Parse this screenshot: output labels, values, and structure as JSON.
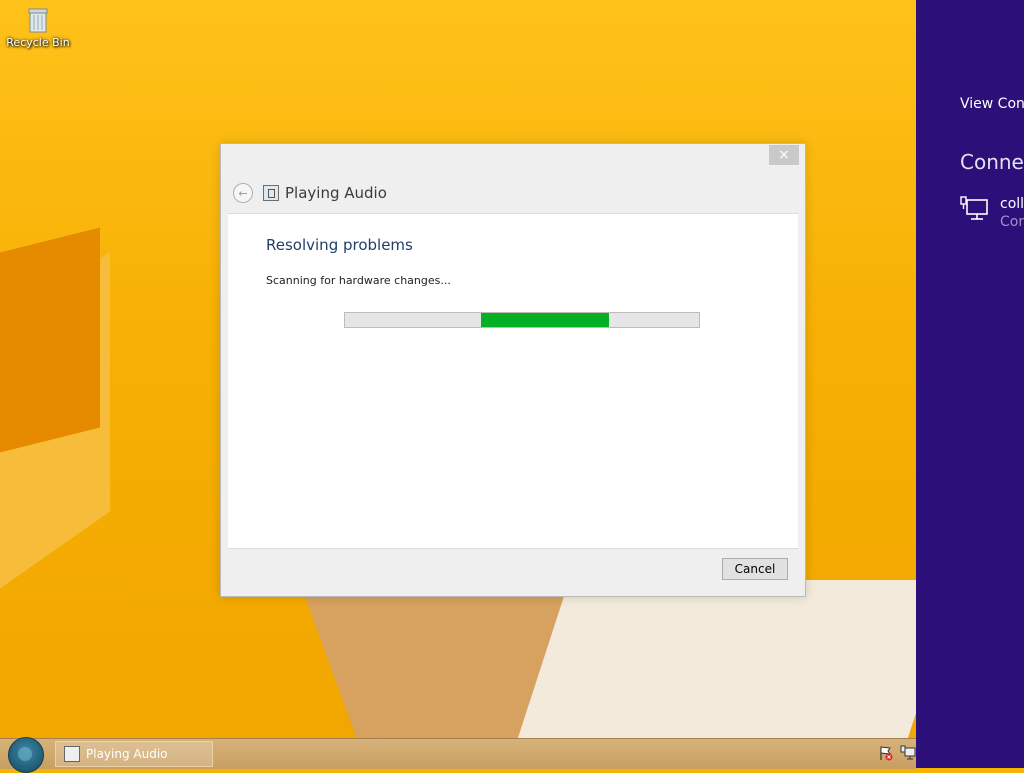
{
  "desktop": {
    "recycle_bin_label": "Recycle Bin"
  },
  "dialog": {
    "title": "Playing Audio",
    "heading": "Resolving problems",
    "status": "Scanning for hardware changes...",
    "progress_fraction": 0.36,
    "cancel_label": "Cancel",
    "close_symbol": "×"
  },
  "charm": {
    "view_link": "View Conn",
    "heading": "Connec",
    "connection_name": "coll",
    "connection_status": "Con"
  },
  "taskbar": {
    "app_label": "Playing Audio"
  },
  "icons": {
    "back": "back-arrow-icon",
    "app": "troubleshooter-icon",
    "network": "network-icon",
    "flag": "action-center-flag-icon"
  },
  "colors": {
    "desktop_bg": "#f7b004",
    "charm_bg": "#2d0f7a",
    "progress_fill": "#06b025",
    "heading": "#1f3f6a"
  }
}
